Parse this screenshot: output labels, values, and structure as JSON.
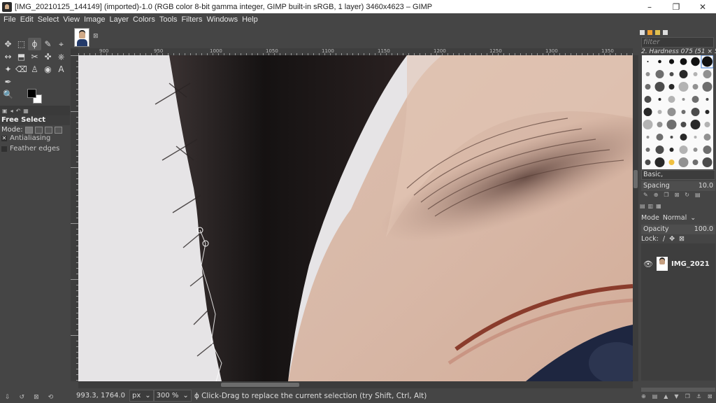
{
  "window": {
    "title": "[IMG_20210125_144149] (imported)-1.0 (RGB color 8-bit gamma integer, GIMP built-in sRGB, 1 layer) 3460x4623 – GIMP",
    "controls": [
      "–",
      "❐",
      "✕"
    ]
  },
  "menu": [
    "File",
    "Edit",
    "Select",
    "View",
    "Image",
    "Layer",
    "Colors",
    "Tools",
    "Filters",
    "Windows",
    "Help"
  ],
  "tools": [
    "✥",
    "⬚",
    "ϕ",
    "✎",
    "⌖",
    "↔",
    "⬒",
    "✂",
    "✜",
    "⎈",
    "✦",
    "⌫",
    "♙",
    "◉",
    "⬛",
    "A",
    "✒",
    "🔍"
  ],
  "tool_options": {
    "title": "Free Select",
    "mode_label": "Mode:",
    "antialiasing": "Antialiasing",
    "feather_edges": "Feather edges"
  },
  "ruler": {
    "top_labels": [
      "900",
      "950",
      "1000",
      "1050",
      "1100",
      "1150",
      "1200",
      "1250",
      "1300",
      "1350"
    ],
    "left_labels": [
      "1",
      "1",
      "1",
      "1",
      "1",
      "1",
      "1"
    ]
  },
  "status": {
    "coords": "993.3, 1764.0",
    "unit": "px",
    "zoom": "300 %",
    "message": "Click-Drag to replace the current selection (try Shift, Ctrl, Alt)"
  },
  "brushes": {
    "filter_placeholder": "filter",
    "current": "2. Hardness 075 (51 × 51)",
    "preset": "Basic,",
    "spacing_label": "Spacing",
    "spacing_value": "10.0"
  },
  "layers": {
    "mode_label": "Mode",
    "mode_value": "Normal",
    "opacity_label": "Opacity",
    "opacity_value": "100.0",
    "lock_label": "Lock:",
    "items": [
      {
        "name": "IMG_2021"
      }
    ]
  }
}
